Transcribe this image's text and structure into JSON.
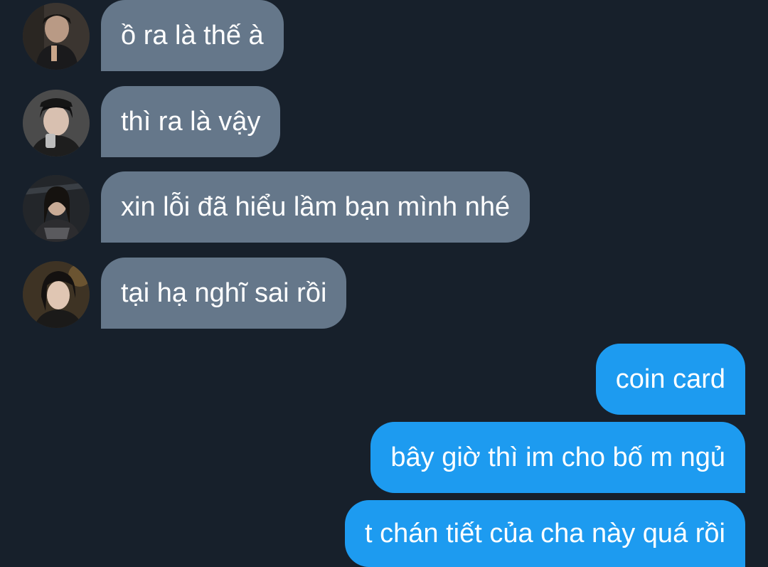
{
  "incoming": [
    {
      "text": "ồ ra là thế à",
      "avatar": "user-photo-1"
    },
    {
      "text": "thì ra là vậy",
      "avatar": "user-photo-2"
    },
    {
      "text": "xin lỗi đã hiểu lầm bạn mình nhé",
      "avatar": "user-photo-3"
    },
    {
      "text": "tại hạ nghĩ sai rồi",
      "avatar": "user-photo-4"
    }
  ],
  "outgoing": [
    {
      "text": "coin card"
    },
    {
      "text": "bây giờ thì im cho bố m ngủ"
    },
    {
      "text": "t chán tiết của cha này quá rồi"
    }
  ],
  "colors": {
    "background": "#17202b",
    "incoming_bubble": "#65778a",
    "outgoing_bubble": "#1d9bf0",
    "text": "#ffffff"
  }
}
